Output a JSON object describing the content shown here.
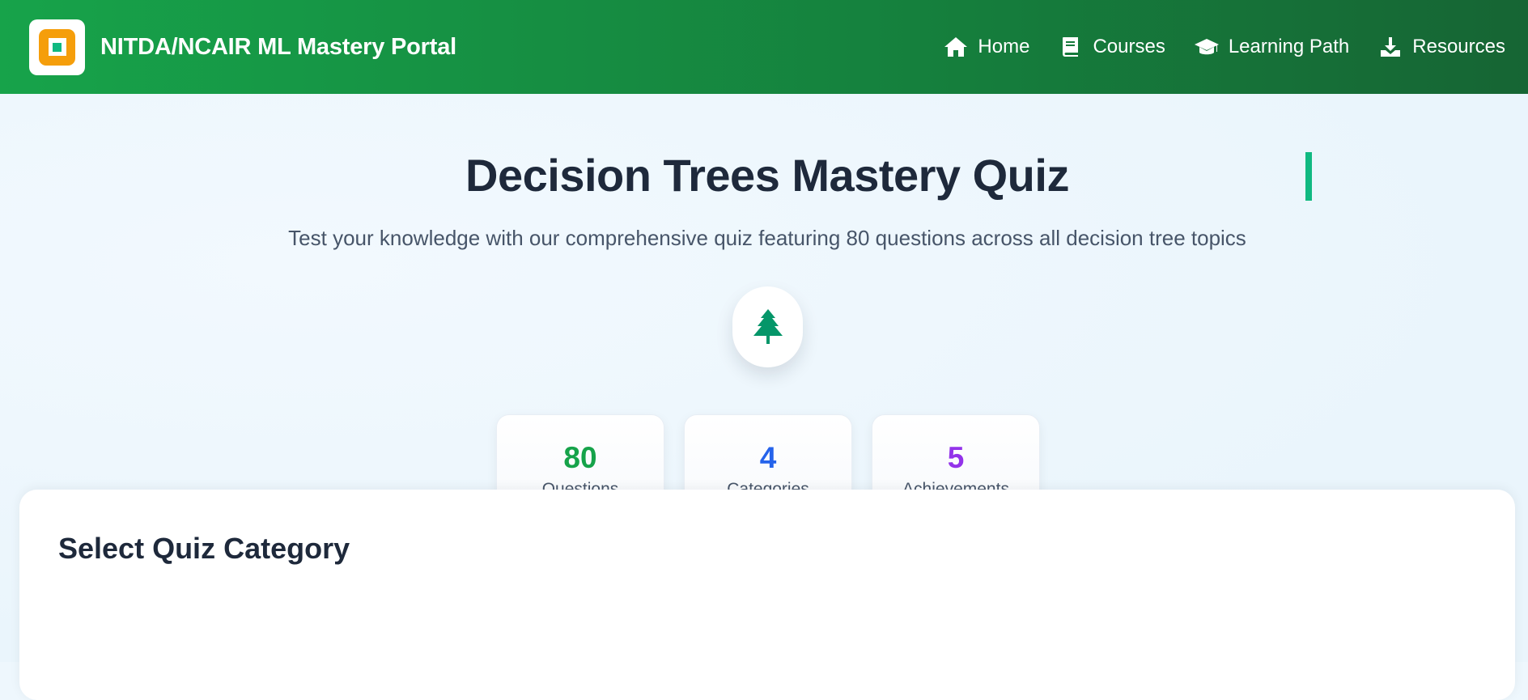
{
  "header": {
    "brand_title": "NITDA/NCAIR ML Mastery Portal",
    "nav": [
      {
        "label": "Home",
        "icon": "home-icon"
      },
      {
        "label": "Courses",
        "icon": "book-icon"
      },
      {
        "label": "Learning Path",
        "icon": "graduation-cap-icon"
      },
      {
        "label": "Resources",
        "icon": "download-icon"
      }
    ]
  },
  "hero": {
    "title": "Decision Trees Mastery Quiz",
    "subtitle": "Test your knowledge with our comprehensive quiz featuring 80 questions across all decision tree topics",
    "badge_icon": "tree-icon"
  },
  "stats": [
    {
      "value": "80",
      "label": "Questions",
      "color": "#16a34a"
    },
    {
      "value": "4",
      "label": "Categories",
      "color": "#2563eb"
    },
    {
      "value": "5",
      "label": "Achievements",
      "color": "#9333ea"
    }
  ],
  "panel": {
    "title": "Select Quiz Category"
  },
  "colors": {
    "header_gradient_start": "#17a34a",
    "header_gradient_end": "#166534",
    "logo_orange": "#f59e0b",
    "accent_green": "#10b981",
    "text_dark": "#1e293b"
  }
}
